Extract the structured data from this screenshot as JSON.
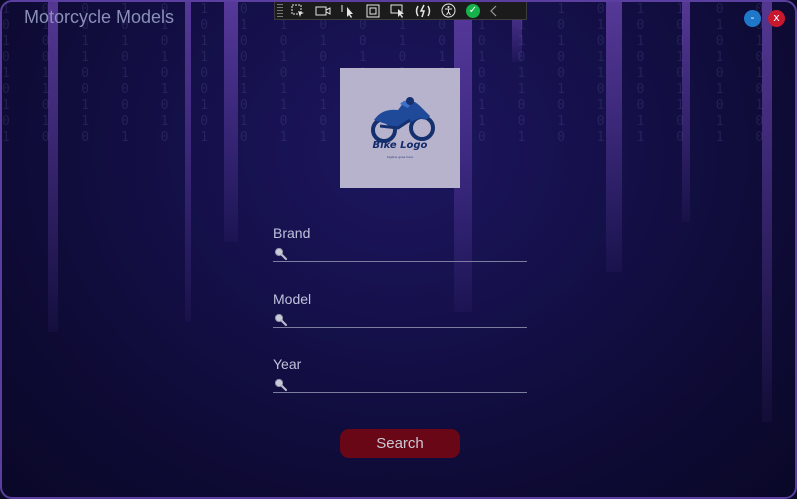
{
  "window": {
    "title": "Motorcycle Models",
    "minimize_label": "-",
    "close_label": "x"
  },
  "toolbar": {
    "icons": [
      "select-element-icon",
      "video-icon",
      "cursor-icon",
      "box-icon",
      "track-focus-icon",
      "hot-reload-icon",
      "accessibility-icon",
      "check-icon",
      "chevron-left-icon"
    ]
  },
  "logo": {
    "title": "Bike Logo",
    "tagline": "tagline goes here"
  },
  "form": {
    "brand": {
      "label": "Brand",
      "value": ""
    },
    "model": {
      "label": "Model",
      "value": ""
    },
    "year": {
      "label": "Year",
      "value": ""
    },
    "search_label": "Search"
  },
  "colors": {
    "background": "#130f45",
    "accent_purple": "#8c5adc",
    "close_button": "#c8182e",
    "minimize_button": "#1f77c8",
    "search_button": "#6a0716"
  }
}
